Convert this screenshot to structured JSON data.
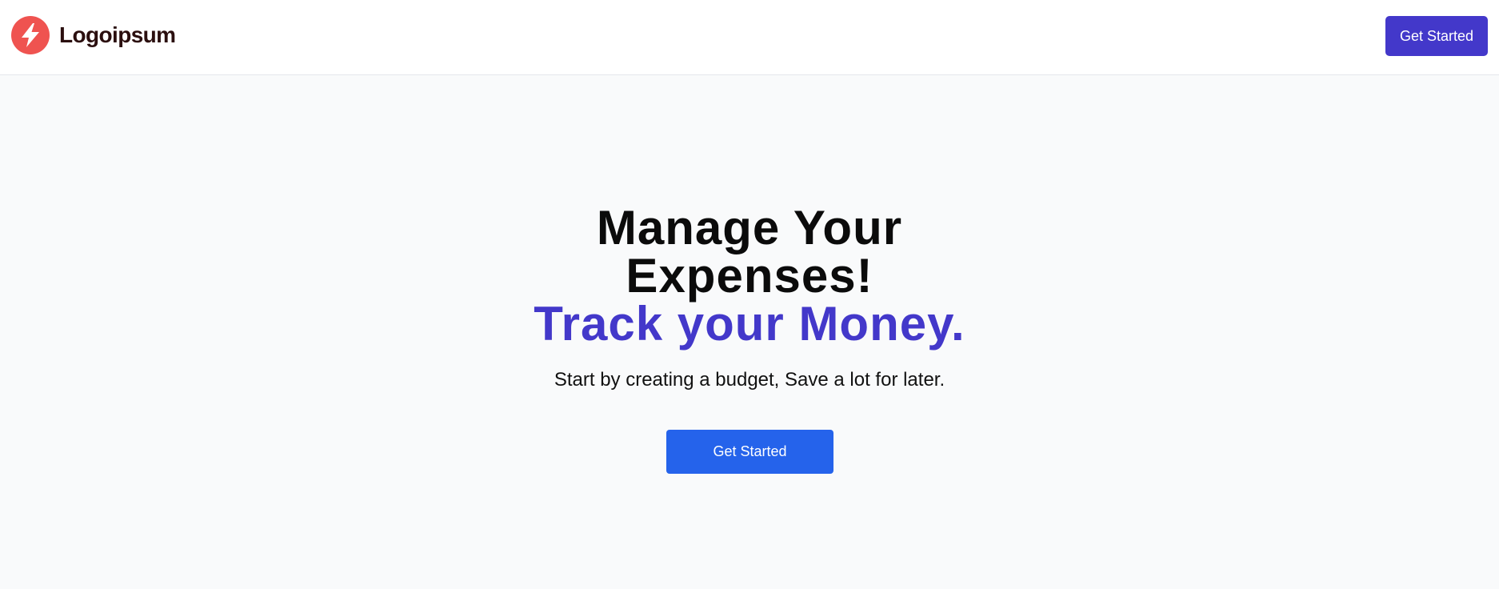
{
  "header": {
    "logo_text": "Logoipsum",
    "logo_icon": "lightning-bolt-icon",
    "cta_label": "Get Started"
  },
  "hero": {
    "title_line1": "Manage Your",
    "title_line2": "Expenses!",
    "title_accent": "Track your Money.",
    "subtitle": "Start by creating a budget, Save a lot for later.",
    "cta_label": "Get Started"
  },
  "colors": {
    "logo_mark": "#ef5350",
    "logo_text": "#2b0f0f",
    "header_button": "#4338ca",
    "accent_text": "#4338ca",
    "hero_button": "#2563eb",
    "background": "#f9fafb"
  }
}
